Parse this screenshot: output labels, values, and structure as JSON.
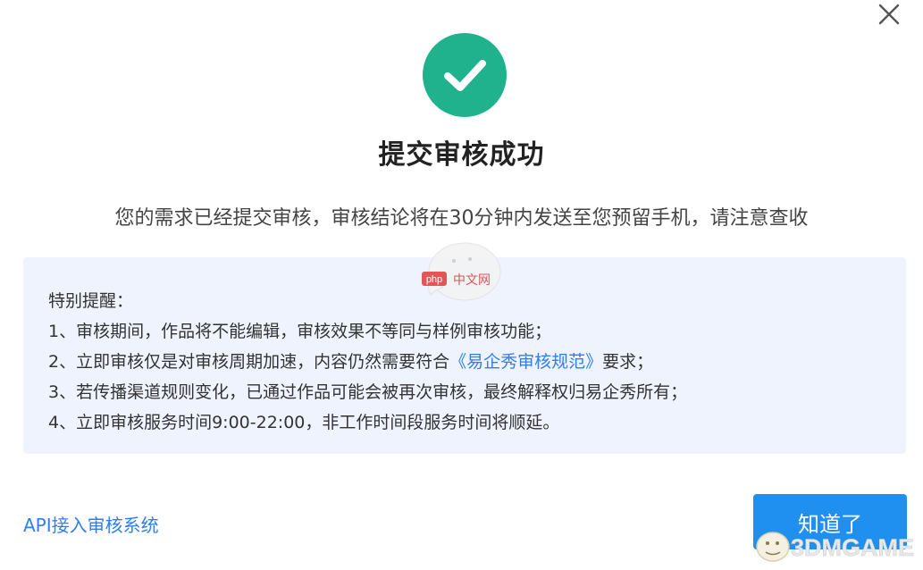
{
  "dialog": {
    "close_icon": "close-icon",
    "success_icon": "check-circle-icon",
    "title": "提交审核成功",
    "subtitle": "您的需求已经提交审核，审核结论将在30分钟内发送至您预留手机，请注意查收"
  },
  "notice": {
    "heading": "特别提醒：",
    "line1": "1、审核期间，作品将不能编辑，审核效果不等同与样例审核功能；",
    "line2_prefix": "2、立即审核仅是对审核周期加速，内容仍然需要符合",
    "line2_link": "《易企秀审核规范》",
    "line2_suffix": "要求；",
    "line3": "3、若传播渠道规则变化，已通过作品可能会被再次审核，最终解释权归易企秀所有；",
    "line4": "4、立即审核服务时间9:00-22:00，非工作时间段服务时间将顺延。"
  },
  "footer": {
    "api_link": "API接入审核系统",
    "ok_button": "知道了"
  },
  "watermarks": {
    "center": "php中文网",
    "corner": "3DMGAME"
  },
  "colors": {
    "success": "#1fb28d",
    "primary": "#1f8ff0",
    "link": "#2f7ef0",
    "notice_bg": "#eef3fd"
  }
}
